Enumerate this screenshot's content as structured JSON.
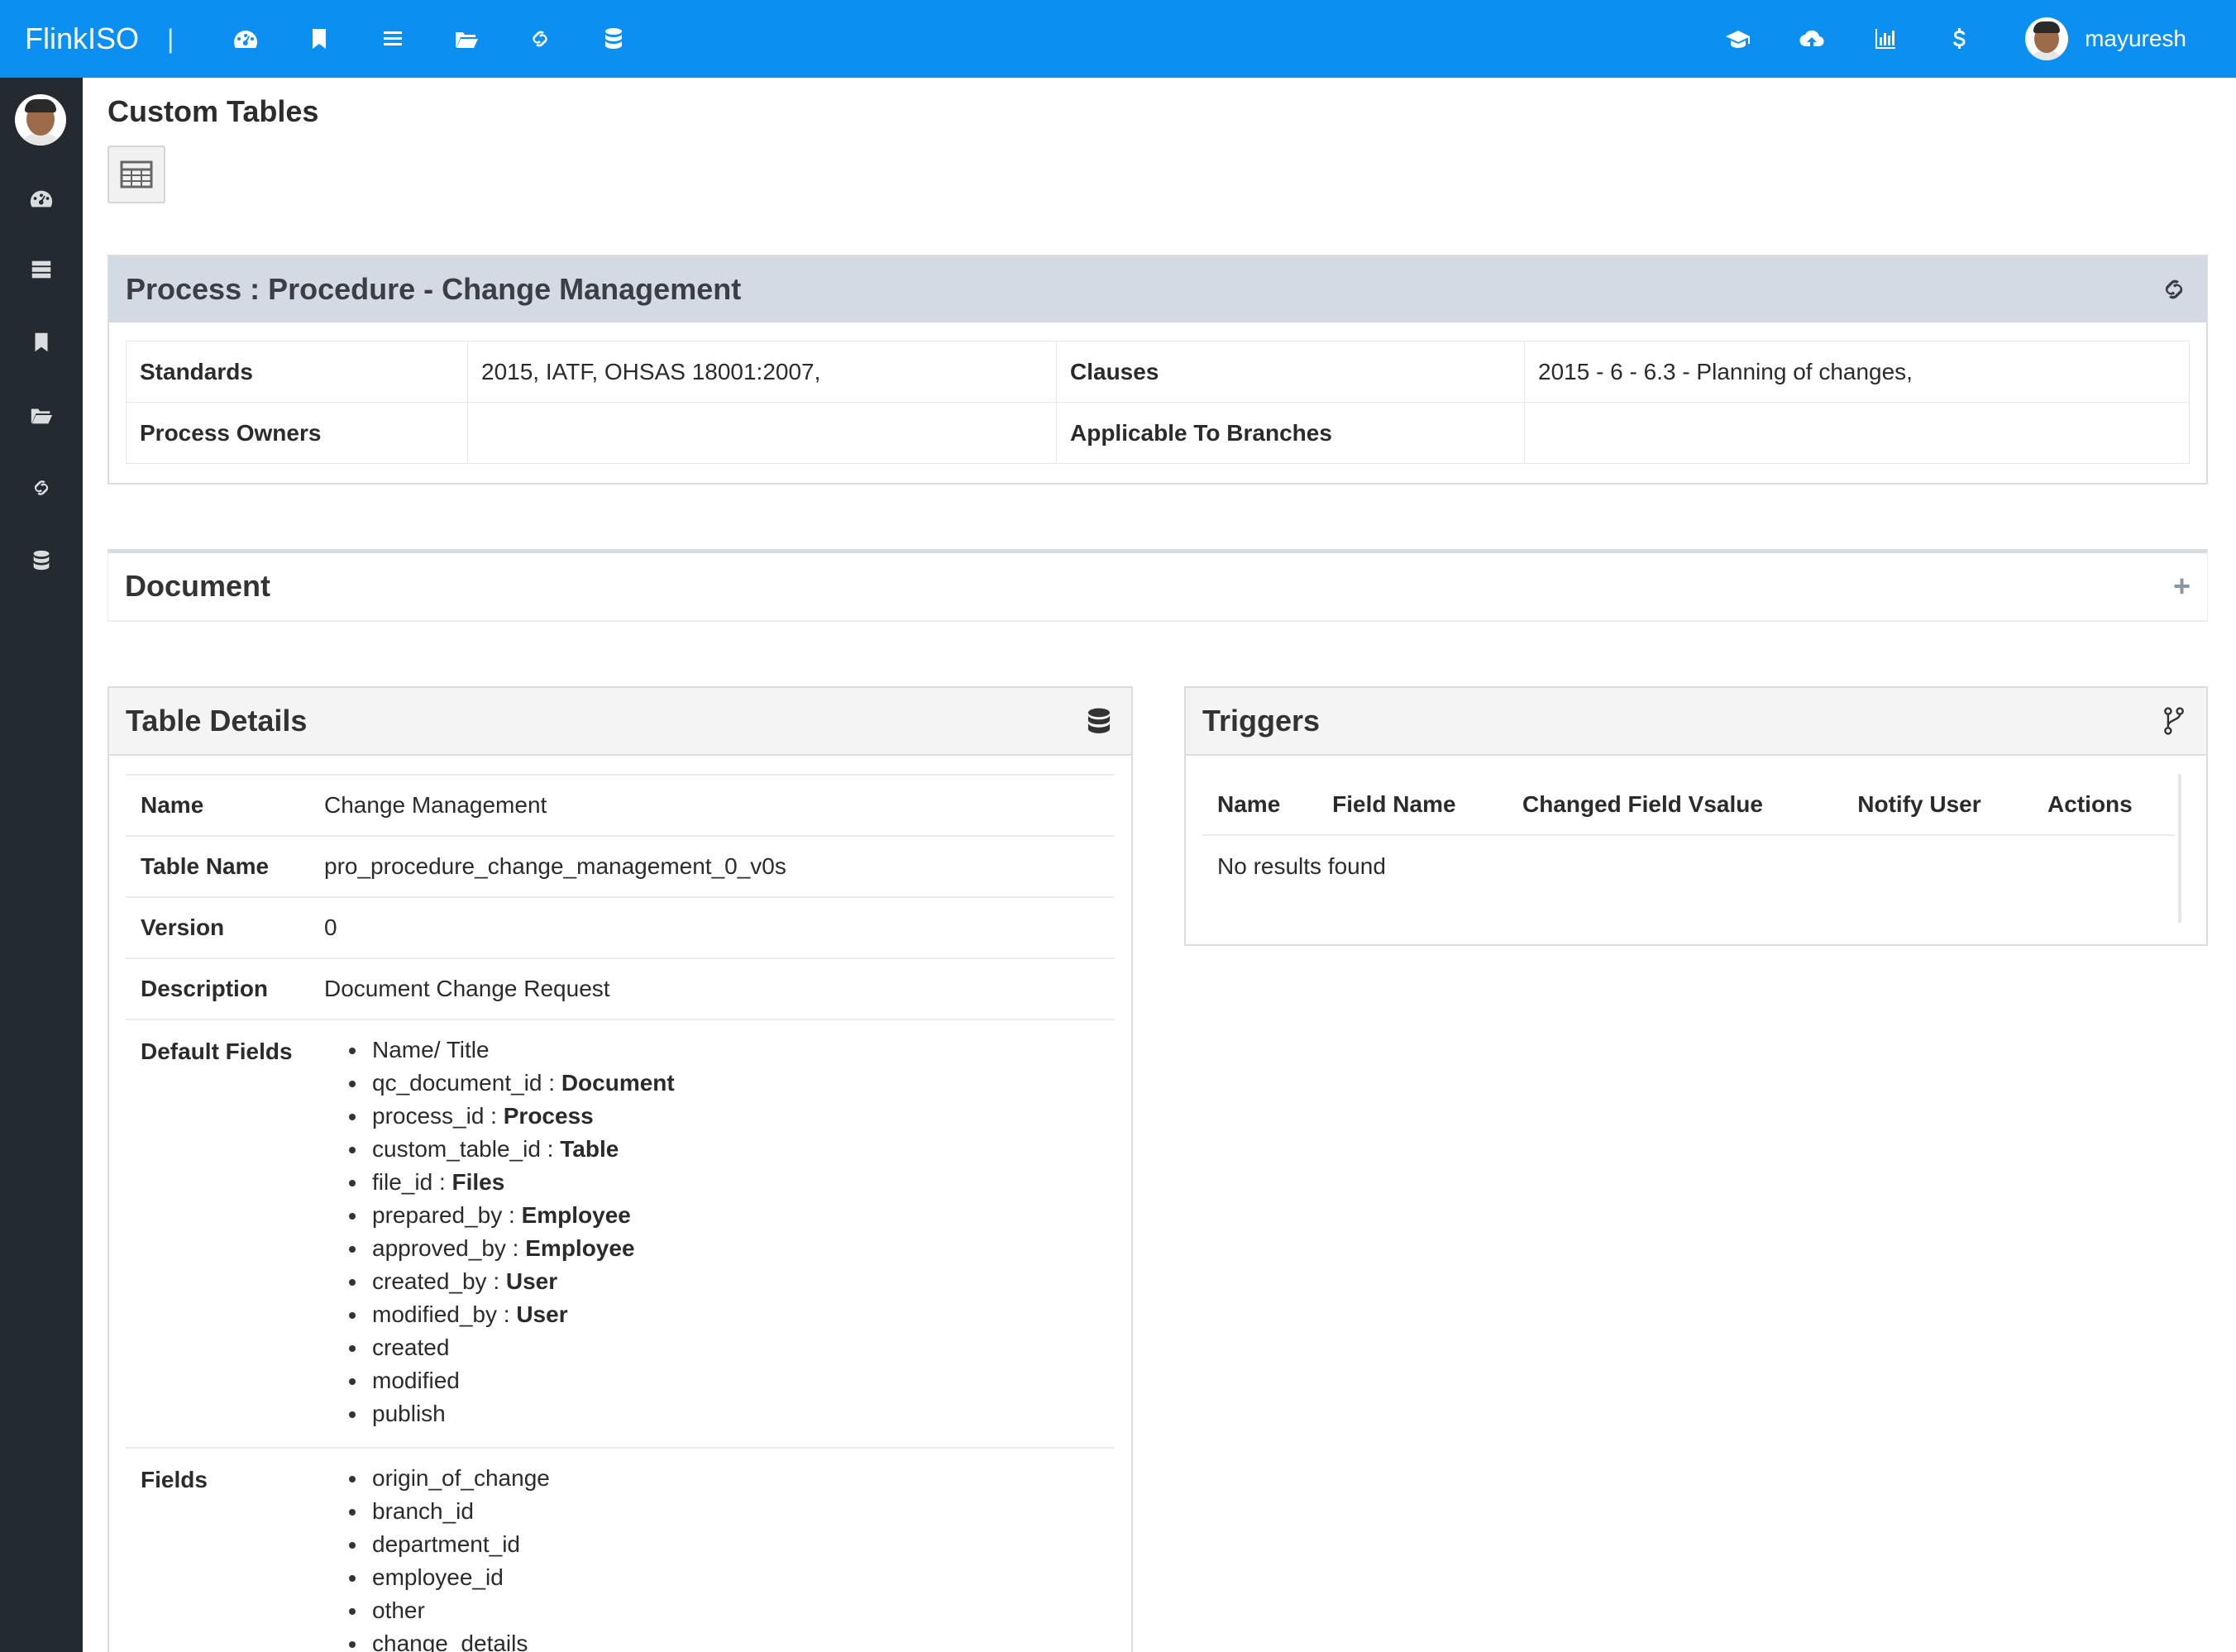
{
  "app": {
    "brand": "FlinkISO",
    "separator": "|"
  },
  "topbar": {
    "nav_icons": [
      "dashboard-icon",
      "bookmark-icon",
      "list-icon",
      "folder-open-icon",
      "link-icon",
      "database-icon"
    ],
    "right_icons": [
      "graduation-cap-icon",
      "cloud-upload-icon",
      "bar-chart-icon",
      "dollar-icon"
    ],
    "username": "mayuresh"
  },
  "sidebar": {
    "icons": [
      "dashboard-icon",
      "server-icon",
      "bookmark-icon",
      "folder-open-icon",
      "link-icon",
      "database-icon"
    ]
  },
  "page": {
    "title": "Custom Tables"
  },
  "process": {
    "title": "Process : Procedure - Change Management",
    "standards_label": "Standards",
    "standards_value": "2015, IATF, OHSAS 18001:2007,",
    "clauses_label": "Clauses",
    "clauses_value": "2015 - 6 - 6.3 - Planning of changes,",
    "owners_label": "Process Owners",
    "owners_value": "",
    "branches_label": "Applicable To Branches",
    "branches_value": ""
  },
  "document": {
    "title": "Document",
    "toggle": "+"
  },
  "details": {
    "title": "Table Details",
    "name_label": "Name",
    "name_value": "Change Management",
    "table_name_label": "Table Name",
    "table_name_value": "pro_procedure_change_management_0_v0s",
    "version_label": "Version",
    "version_value": "0",
    "description_label": "Description",
    "description_value": "Document Change Request",
    "default_fields_label": "Default Fields",
    "default_fields": [
      {
        "name": "Name/ Title",
        "sep": "",
        "type": ""
      },
      {
        "name": "qc_document_id",
        "sep": " : ",
        "type": "Document"
      },
      {
        "name": "process_id",
        "sep": " : ",
        "type": "Process"
      },
      {
        "name": "custom_table_id",
        "sep": " : ",
        "type": "Table"
      },
      {
        "name": "file_id",
        "sep": " : ",
        "type": "Files"
      },
      {
        "name": "prepared_by",
        "sep": " : ",
        "type": "Employee"
      },
      {
        "name": "approved_by",
        "sep": " : ",
        "type": "Employee"
      },
      {
        "name": "created_by",
        "sep": " : ",
        "type": "User"
      },
      {
        "name": "modified_by",
        "sep": " : ",
        "type": "User"
      },
      {
        "name": "created",
        "sep": "",
        "type": ""
      },
      {
        "name": "modified",
        "sep": "",
        "type": ""
      },
      {
        "name": "publish",
        "sep": "",
        "type": ""
      }
    ],
    "fields_label": "Fields",
    "fields": [
      "origin_of_change",
      "branch_id",
      "department_id",
      "employee_id",
      "other",
      "change_details"
    ]
  },
  "triggers": {
    "title": "Triggers",
    "columns": [
      "Name",
      "Field Name",
      "Changed Field Vsalue",
      "Notify User",
      "Actions"
    ],
    "empty_message": "No results found"
  }
}
